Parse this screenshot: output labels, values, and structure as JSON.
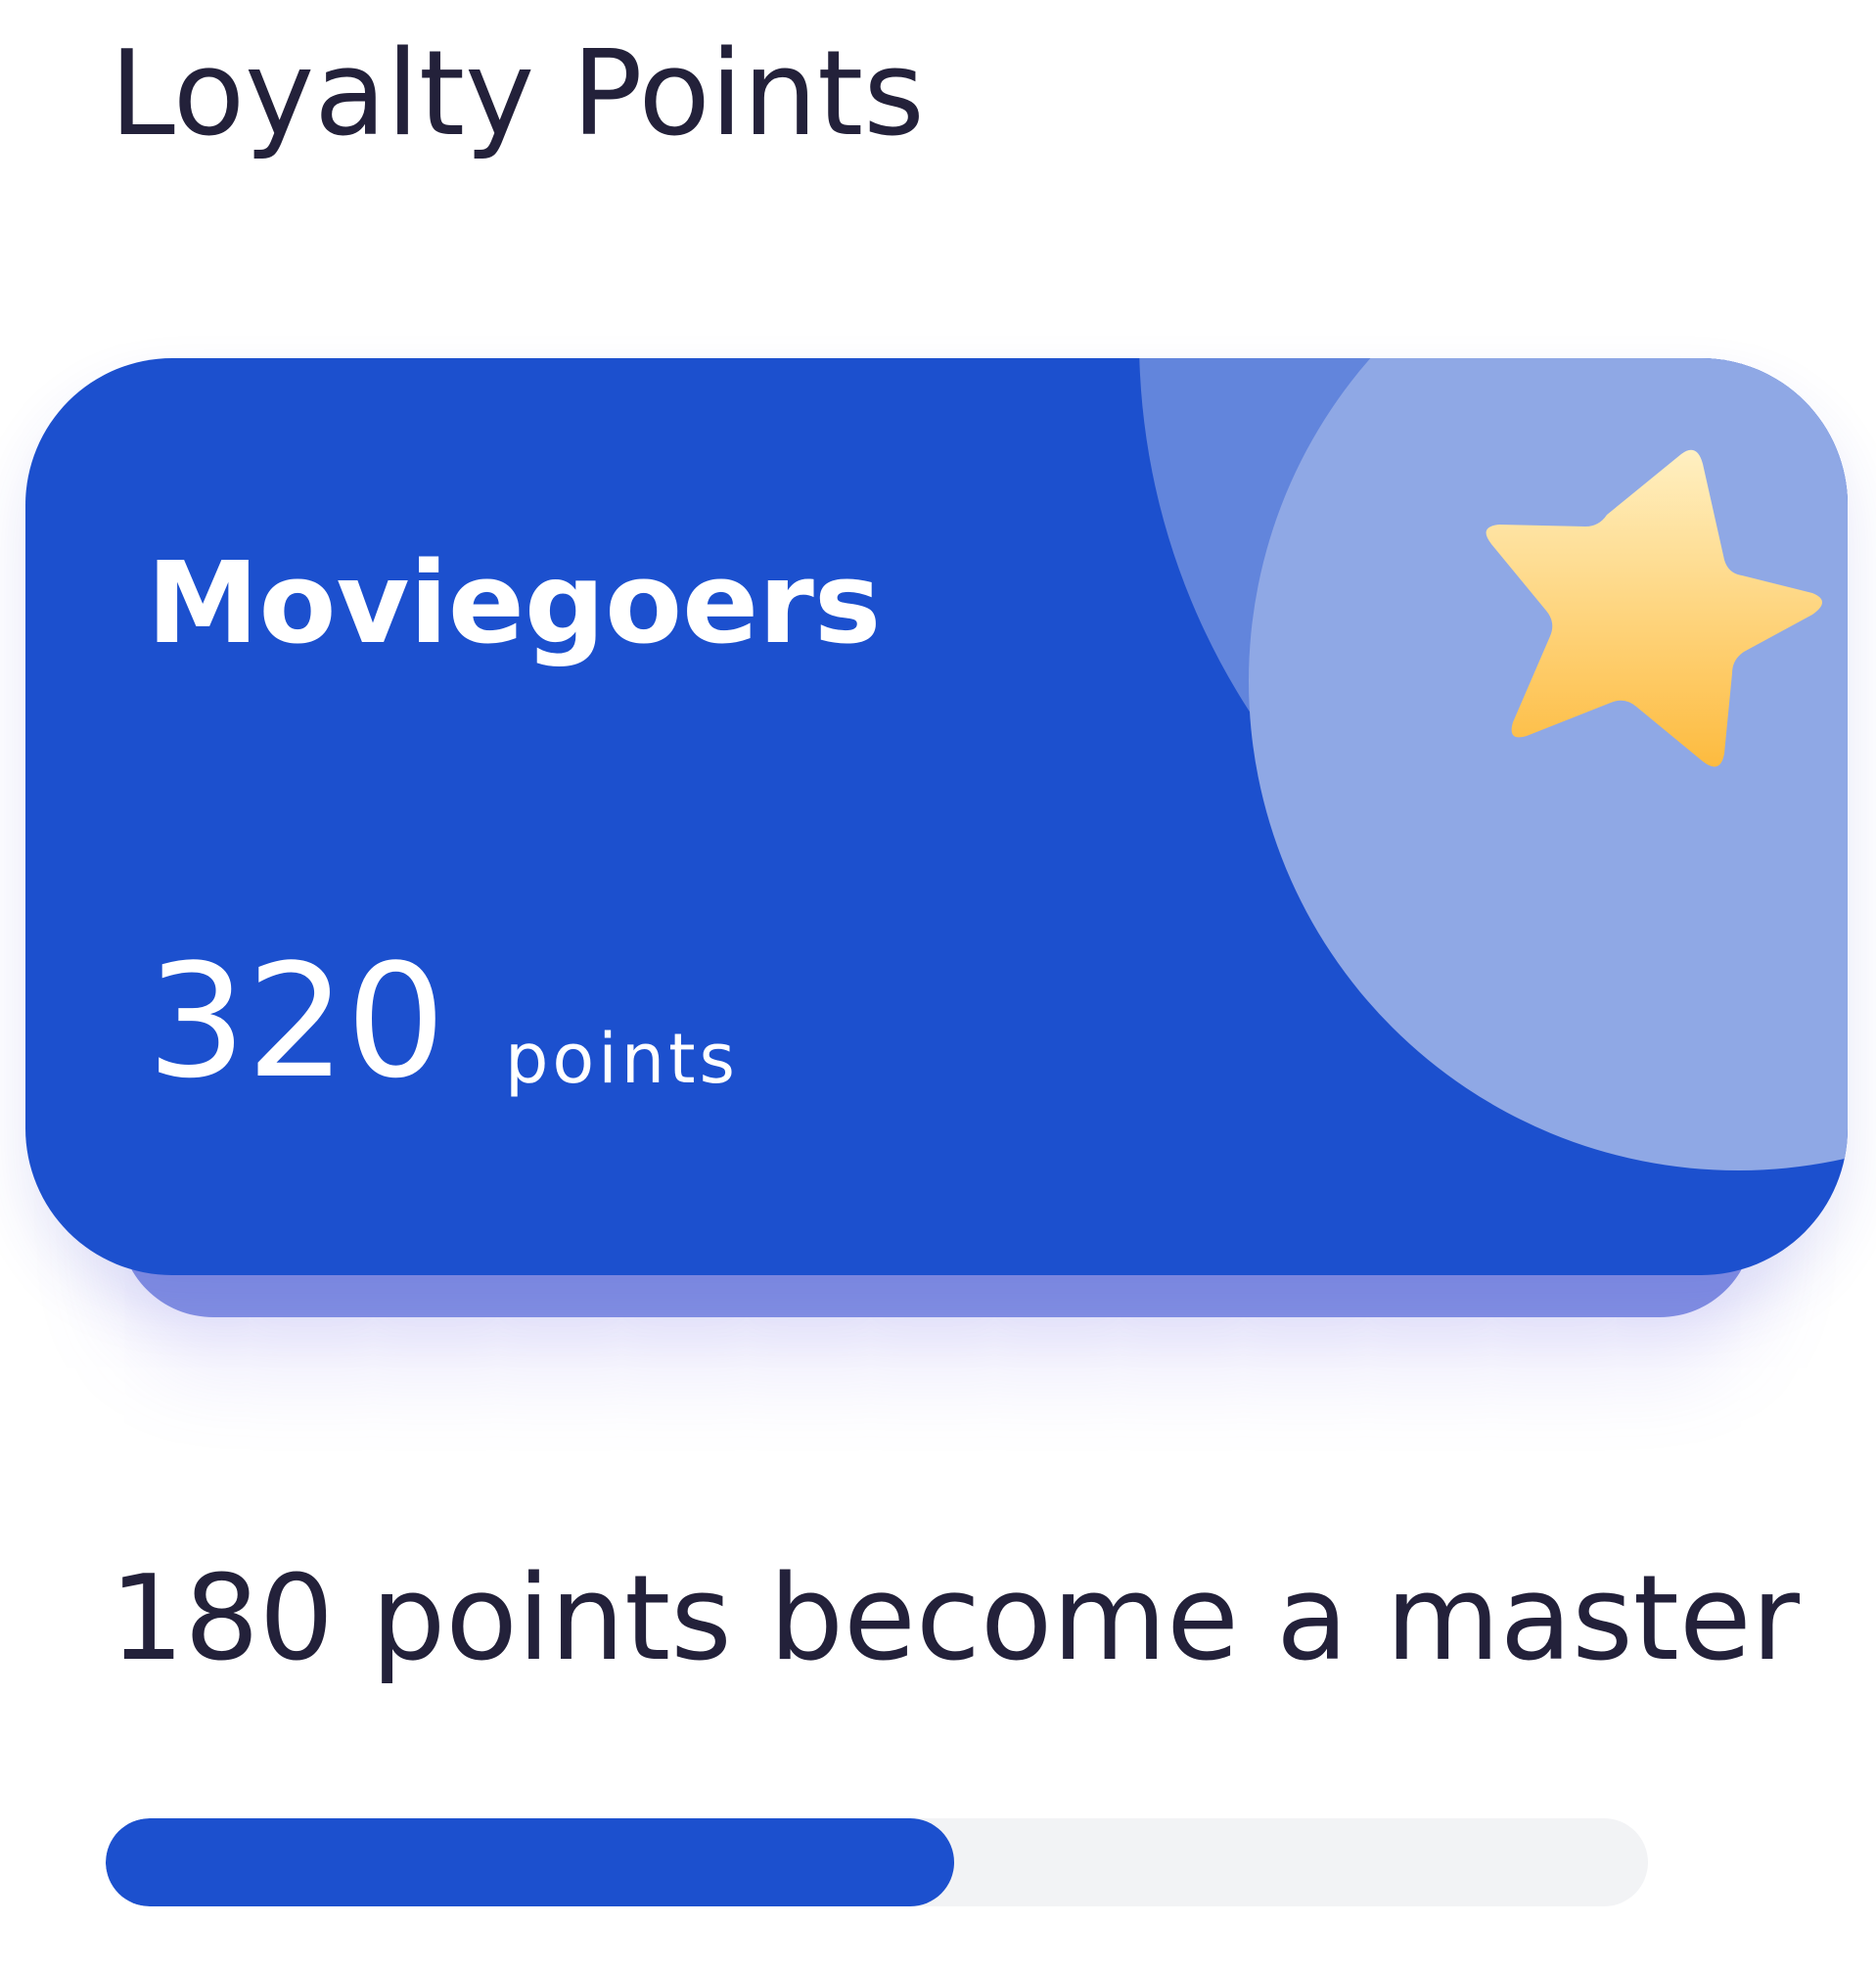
{
  "header": {
    "title": "Loyalty Points"
  },
  "loyalty_card": {
    "tier_name": "Moviegoers",
    "points_value": "320",
    "points_unit": "points",
    "badge_icon": "star-icon"
  },
  "progress": {
    "label": "180 points become a master",
    "fraction": 0.55
  },
  "colors": {
    "card_blue": "#1c50ce",
    "card_back": "#8390e3",
    "circle_outer": "#6285dc",
    "circle_inner": "#8fa8e5",
    "progress_fill": "#1c50ce",
    "progress_track": "#f2f3f5",
    "text_dark": "#23213a",
    "star_top": "#fff0c2",
    "star_bottom": "#fdbb3f"
  }
}
